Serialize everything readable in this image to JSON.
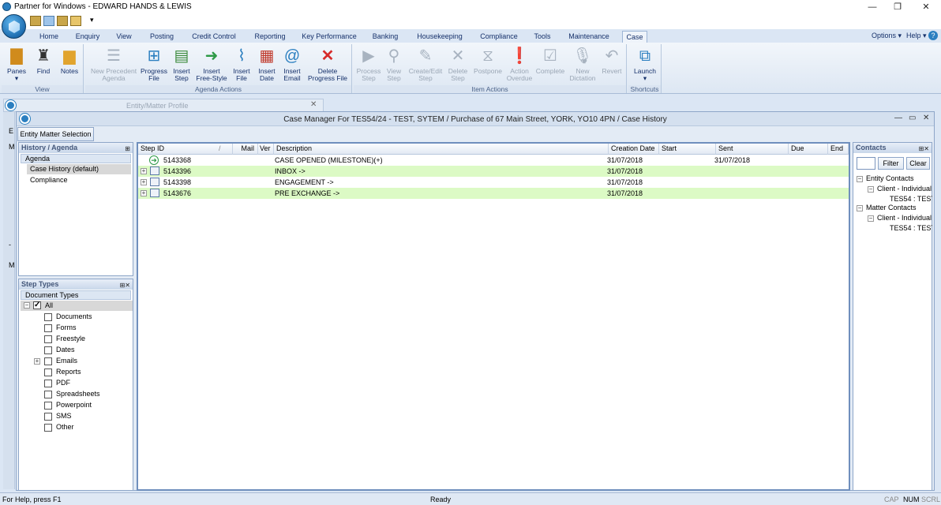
{
  "app": {
    "title": "Partner for Windows - EDWARD HANDS & LEWIS",
    "minimize": "—",
    "restore": "❐",
    "close": "✕",
    "qat_dropdown": "▾"
  },
  "tabs": [
    "Home",
    "Enquiry",
    "View",
    "Posting",
    "Credit Control",
    "Reporting",
    "Key Performance",
    "Banking",
    "Housekeeping",
    "Compliance",
    "Tools",
    "Maintenance",
    "Case"
  ],
  "active_tab": "Case",
  "right_menu": {
    "options": "Options",
    "help": "Help",
    "caret": "▾",
    "help_icon": "?"
  },
  "ribbon": {
    "groups": {
      "view": "View",
      "agenda_actions": "Agenda Actions",
      "item_actions": "Item Actions",
      "shortcuts": "Shortcuts"
    },
    "view_buttons": [
      {
        "label": "Panes",
        "sub": "▾",
        "icon": "briefcase-icon"
      },
      {
        "label": "Find",
        "sub": "",
        "icon": "binoculars-icon"
      },
      {
        "label": "Notes",
        "sub": "",
        "icon": "folder-icon"
      }
    ],
    "agenda_buttons": [
      {
        "line1": "New Precedent",
        "line2": "Agenda",
        "icon": "precedent-icon",
        "disabled": true
      },
      {
        "line1": "Progress",
        "line2": "File",
        "icon": "progress-icon",
        "disabled": false
      },
      {
        "line1": "Insert",
        "line2": "Step",
        "icon": "insert-step-icon",
        "disabled": false
      },
      {
        "line1": "Insert",
        "line2": "Free-Style",
        "icon": "arrow-circle-icon",
        "disabled": false
      },
      {
        "line1": "Insert",
        "line2": "File",
        "icon": "paperclip-icon",
        "disabled": false
      },
      {
        "line1": "Insert",
        "line2": "Date",
        "icon": "calendar-icon",
        "disabled": false
      },
      {
        "line1": "Insert",
        "line2": "Email",
        "icon": "at-icon",
        "disabled": false
      },
      {
        "line1": "Delete",
        "line2": "Progress File",
        "icon": "delete-icon",
        "disabled": false
      }
    ],
    "item_buttons": [
      {
        "line1": "Process",
        "line2": "Step",
        "icon": "play-icon"
      },
      {
        "line1": "View",
        "line2": "Step",
        "icon": "magnifier-icon"
      },
      {
        "line1": "Create/Edit",
        "line2": "Step",
        "icon": "pencil-icon"
      },
      {
        "line1": "Delete",
        "line2": "Step",
        "icon": "x-icon"
      },
      {
        "line1": "Postpone",
        "line2": "",
        "icon": "postpone-icon"
      },
      {
        "line1": "Action",
        "line2": "Overdue",
        "icon": "warning-icon"
      },
      {
        "line1": "Complete",
        "line2": "",
        "icon": "check-icon"
      },
      {
        "line1": "New",
        "line2": "Dictation",
        "icon": "microphone-icon"
      },
      {
        "line1": "Revert",
        "line2": "",
        "icon": "undo-icon"
      }
    ],
    "launch": {
      "label": "Launch",
      "sub": "▾",
      "icon": "launch-icon"
    }
  },
  "bg_child": {
    "title": "Entity/Matter Profile",
    "close": "✕",
    "letters": [
      "E",
      "M",
      "-",
      "M"
    ]
  },
  "case_manager": {
    "title": "Case Manager For TES54/24 - TEST, SYTEM / Purchase of 67 Main Street, YORK, YO10 4PN / Case History",
    "min": "—",
    "max": "▭",
    "close": "✕",
    "entity_button": "Entity Matter Selection"
  },
  "history": {
    "header": "History / Agenda",
    "pin": "⊞",
    "subheader": "Agenda",
    "items": [
      "Case History (default)",
      "Compliance"
    ]
  },
  "step_types": {
    "header": "Step Types",
    "pin": "⊞✕",
    "subheader": "Document Types",
    "expand_minus": "−",
    "expand_plus": "+",
    "all": "All",
    "items": [
      "Documents",
      "Forms",
      "Freestyle",
      "Dates",
      "Emails",
      "Reports",
      "PDF",
      "Spreadsheets",
      "Powerpoint",
      "SMS",
      "Other"
    ]
  },
  "grid": {
    "columns": [
      "Step ID",
      "Mail",
      "Ver",
      "Description",
      "Creation Date",
      "Start",
      "Sent",
      "Due",
      "End"
    ],
    "sort_glyph": "/",
    "expand_glyph": "+",
    "rows": [
      {
        "id": "5143368",
        "description": "CASE OPENED (MILESTONE)(+)",
        "creation": "31/07/2018",
        "sent": "31/07/2018",
        "highlight": false,
        "icon": "arrow-circle-icon",
        "expandable": false
      },
      {
        "id": "5143396",
        "description": "INBOX ->",
        "creation": "31/07/2018",
        "sent": "",
        "highlight": true,
        "icon": "calendar-icon",
        "expandable": true
      },
      {
        "id": "5143398",
        "description": "ENGAGEMENT ->",
        "creation": "31/07/2018",
        "sent": "",
        "highlight": false,
        "icon": "calendar-icon",
        "expandable": true
      },
      {
        "id": "5143676",
        "description": "PRE EXCHANGE ->",
        "creation": "31/07/2018",
        "sent": "",
        "highlight": true,
        "icon": "calendar-icon",
        "expandable": true
      }
    ]
  },
  "contacts": {
    "header": "Contacts",
    "pin": "⊞✕",
    "filter": "Filter",
    "clear": "Clear",
    "tree": [
      {
        "label": "Entity Contacts",
        "level": 0,
        "glyph": "−"
      },
      {
        "label": "Client - Individual",
        "level": 1,
        "glyph": "−"
      },
      {
        "label": "TES54 : TEST",
        "level": 2,
        "glyph": ""
      },
      {
        "label": "Matter Contacts",
        "level": 0,
        "glyph": "−"
      },
      {
        "label": "Client - Individual",
        "level": 1,
        "glyph": "−"
      },
      {
        "label": "TES54 : TEST",
        "level": 2,
        "glyph": ""
      }
    ]
  },
  "status": {
    "help": "For Help, press F1",
    "ready": "Ready",
    "cap": "CAP",
    "num": "NUM",
    "scrl": "SCRL"
  },
  "colors": {
    "accent": "#2b7fc0",
    "highlight_row": "#dcfac5",
    "delete": "#d62b2b"
  }
}
